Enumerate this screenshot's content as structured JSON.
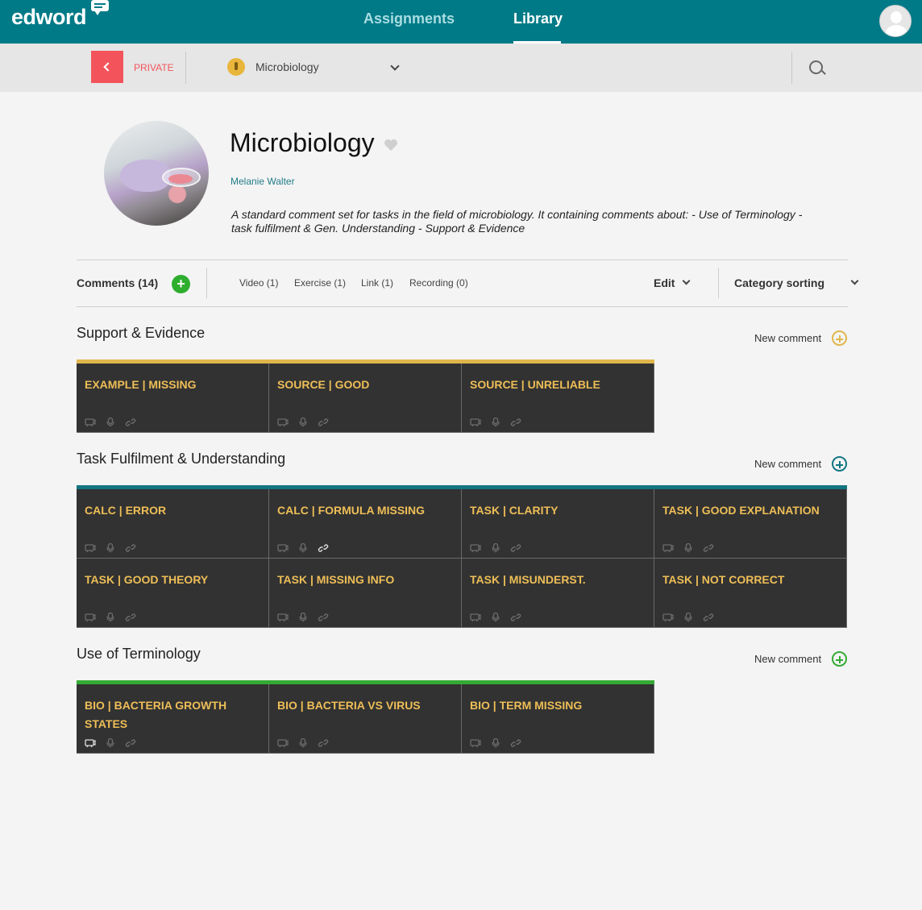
{
  "brand": {
    "name": "edword"
  },
  "nav": {
    "assignments": "Assignments",
    "library": "Library"
  },
  "subbar": {
    "visibility": "PRIVATE",
    "collection": "Microbiology"
  },
  "header": {
    "title": "Microbiology",
    "author": "Melanie Walter",
    "description": "A standard comment set for tasks in the field of microbiology. It containing comments about: - Use of Terminology - task fulfilment & Gen. Understanding - Support & Evidence"
  },
  "filters": {
    "comments": "Comments (14)",
    "video": "Video (1)",
    "exercise": "Exercise (1)",
    "link": "Link (1)",
    "recording": "Recording (0)",
    "edit": "Edit",
    "sorting": "Category sorting"
  },
  "colors": {
    "support": "#e0b64c",
    "task": "#137582",
    "terminology": "#35aa35",
    "card_bg": "#323232",
    "card_title": "#eebe57"
  },
  "sections": [
    {
      "title": "Support & Evidence",
      "new_comment": "New comment",
      "cards": [
        {
          "title": "EXAMPLE | MISSING",
          "video": false,
          "link": false
        },
        {
          "title": "SOURCE | GOOD",
          "video": false,
          "link": false
        },
        {
          "title": "SOURCE | UNRELIABLE",
          "video": false,
          "link": false
        }
      ]
    },
    {
      "title": "Task Fulfilment & Understanding",
      "new_comment": "New comment",
      "cards": [
        {
          "title": "CALC | ERROR",
          "video": false,
          "link": false
        },
        {
          "title": "CALC | FORMULA MISSING",
          "video": false,
          "link": true
        },
        {
          "title": "TASK | CLARITY",
          "video": false,
          "link": false
        },
        {
          "title": "TASK | GOOD EXPLANATION",
          "video": false,
          "link": false
        },
        {
          "title": "TASK | GOOD THEORY",
          "video": false,
          "link": false
        },
        {
          "title": "TASK | MISSING INFO",
          "video": false,
          "link": false
        },
        {
          "title": "TASK | MISUNDERST.",
          "video": false,
          "link": false
        },
        {
          "title": "TASK | NOT CORRECT",
          "video": false,
          "link": false
        }
      ]
    },
    {
      "title": "Use of Terminology",
      "new_comment": "New comment",
      "cards": [
        {
          "title": "BIO | BACTERIA GROWTH STATES",
          "video": true,
          "link": false
        },
        {
          "title": "BIO | BACTERIA VS VIRUS",
          "video": false,
          "link": false
        },
        {
          "title": "BIO | TERM MISSING",
          "video": false,
          "link": false
        }
      ]
    }
  ]
}
